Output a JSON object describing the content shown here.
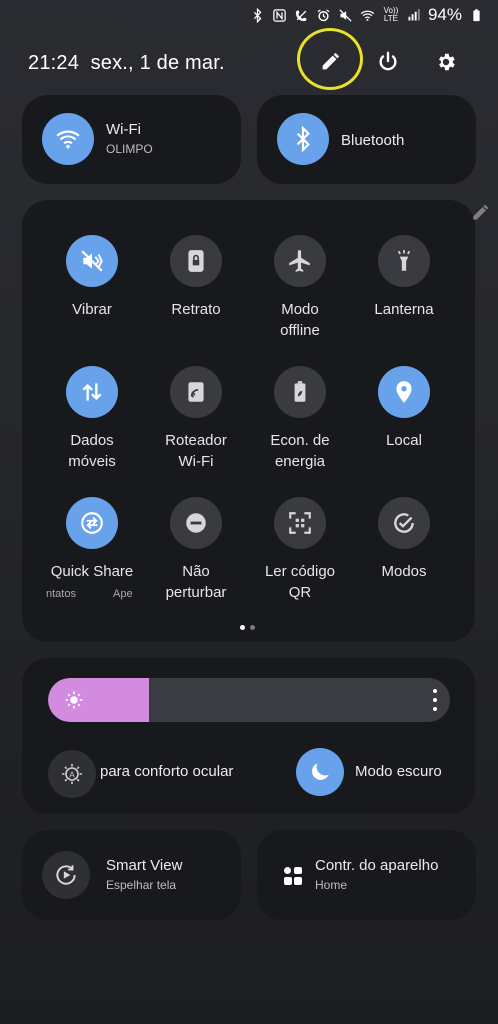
{
  "status_bar": {
    "icons": [
      "bluetooth-icon",
      "nfc-icon",
      "no-call-icon",
      "alarm-icon",
      "mute-icon",
      "wifi-icon",
      "volte-icon",
      "signal-icon"
    ],
    "volte_text": "Vo)) LTE",
    "battery_percent": "94%"
  },
  "header": {
    "time": "21:24",
    "date": "sex., 1 de mar.",
    "buttons": [
      "edit-icon",
      "power-icon",
      "settings-icon"
    ]
  },
  "connections": {
    "wifi": {
      "label": "Wi-Fi",
      "sub": "OLIMPO",
      "on": true
    },
    "bluetooth": {
      "label": "Bluetooth",
      "on": true
    }
  },
  "tiles": [
    {
      "label": "Vibrar",
      "icon": "vibrate-icon",
      "on": true
    },
    {
      "label": "Retrato",
      "icon": "portrait-lock-icon",
      "on": false
    },
    {
      "label": "Modo offline",
      "icon": "airplane-icon",
      "on": false
    },
    {
      "label": "Lanterna",
      "icon": "flashlight-icon",
      "on": false
    },
    {
      "label": "Dados móveis",
      "icon": "mobile-data-icon",
      "on": true
    },
    {
      "label": "Roteador Wi-Fi",
      "icon": "hotspot-icon",
      "on": false
    },
    {
      "label": "Econ. de energia",
      "icon": "power-saving-icon",
      "on": false
    },
    {
      "label": "Local",
      "icon": "location-icon",
      "on": true
    },
    {
      "label": "Quick Share",
      "icon": "quick-share-icon",
      "on": true,
      "sub_a": "ntatos",
      "sub_b": "Ape"
    },
    {
      "label": "Não perturbar",
      "icon": "do-not-disturb-icon",
      "on": false
    },
    {
      "label": "Ler código QR",
      "icon": "qr-code-icon",
      "on": false
    },
    {
      "label": "Modos",
      "icon": "modes-icon",
      "on": false
    }
  ],
  "tile_labels": {
    "vibrar": "Vibrar",
    "retrato": "Retrato",
    "modo_1": "Modo",
    "modo_2": "offline",
    "lanterna": "Lanterna",
    "dados_1": "Dados",
    "dados_2": "móveis",
    "roteador_1": "Roteador",
    "roteador_2": "Wi-Fi",
    "econ_1": "Econ. de",
    "econ_2": "energia",
    "local": "Local",
    "quick_share": "Quick Share",
    "quick_sub_a": "ntatos",
    "quick_sub_b": "Ape",
    "nao_1": "Não",
    "nao_2": "perturbar",
    "ler_1": "Ler código",
    "ler_2": "QR",
    "modos": "Modos"
  },
  "pager": {
    "pages": 2,
    "active": 1
  },
  "brightness": {
    "level": 0.25
  },
  "eye_comfort": {
    "label": "para conforto ocular",
    "on": false
  },
  "dark_mode": {
    "label": "Modo escuro",
    "on": true
  },
  "bottom": {
    "smart_view": {
      "label": "Smart View",
      "sub": "Espelhar tela"
    },
    "device_control": {
      "label": "Contr. do aparelho",
      "sub": "Home"
    }
  },
  "colors": {
    "accent": "#67a2ea",
    "brightness_fill": "#d38be0",
    "highlight_ring": "#e9e22a"
  }
}
